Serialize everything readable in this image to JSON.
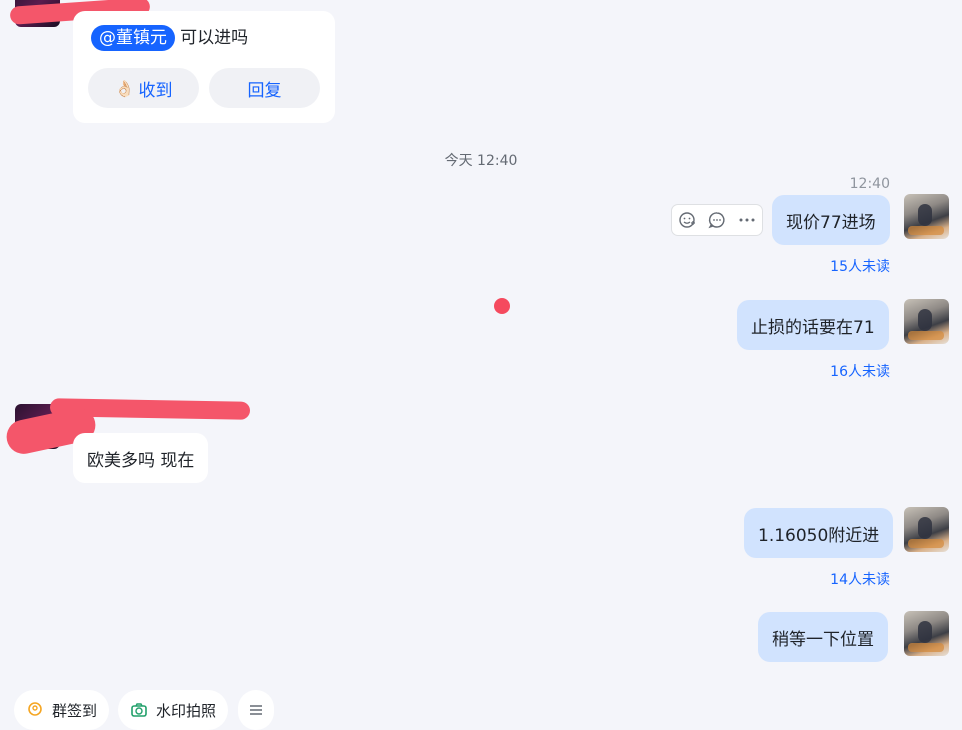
{
  "top_message": {
    "mention": "@董镇元",
    "text": "可以进吗",
    "ack_button": "收到",
    "ack_emoji": "👌🏻",
    "reply_button": "回复"
  },
  "divider_time": "今天 12:40",
  "messages_right": [
    {
      "time": "12:40",
      "text": "现价77进场",
      "unread": "15人未读"
    },
    {
      "text": "止损的话要在71",
      "unread": "16人未读"
    },
    {
      "text": "1.16050附近进",
      "unread": "14人未读"
    },
    {
      "text": "稍等一下位置"
    }
  ],
  "message_left": {
    "text": "欧美多吗 现在"
  },
  "bottom_bar": {
    "checkin_label": "群签到",
    "photo_label": "水印拍照",
    "menu_icon": "list-icon"
  },
  "colors": {
    "accent": "#1664ff",
    "bubble_mine": "#d1e3fe",
    "background": "#f4f5fa",
    "redaction": "#f4566a"
  }
}
